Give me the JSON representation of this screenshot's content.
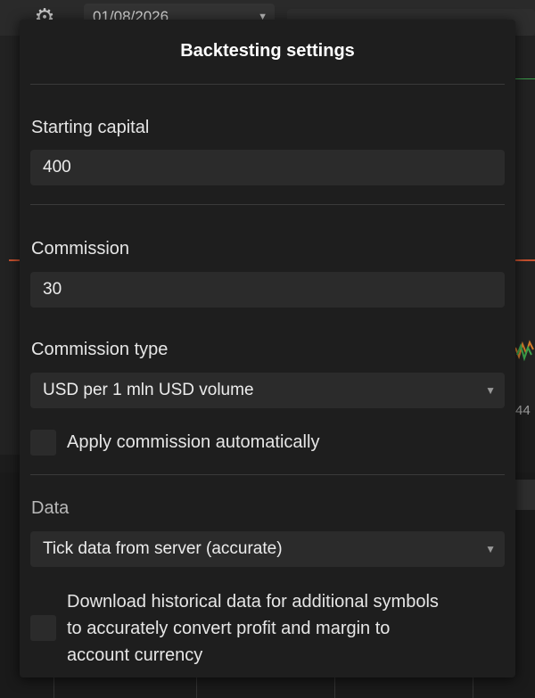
{
  "background": {
    "settings_icon": "gear-icon",
    "date_value": "01/08/2026",
    "axis_label_partial": "44"
  },
  "dialog": {
    "title": "Backtesting settings",
    "starting_capital": {
      "label": "Starting capital",
      "value": "400"
    },
    "commission": {
      "label": "Commission",
      "value": "30"
    },
    "commission_type": {
      "label": "Commission type",
      "selected": "USD per 1 mln USD volume"
    },
    "apply_commission": {
      "label": "Apply commission automatically",
      "checked": false
    },
    "data": {
      "label": "Data",
      "selected": "Tick data from server (accurate)"
    },
    "download_historical": {
      "label_lines": [
        "Download historical data for additional symbols",
        "to accurately convert profit and margin to",
        "account currency"
      ],
      "checked": false
    }
  },
  "colors": {
    "dialog_bg": "#1e1e1e",
    "field_bg": "#2b2b2b",
    "text": "#e6e6e6",
    "muted_text": "#b8b8b8",
    "divider": "#3a3a3a"
  }
}
